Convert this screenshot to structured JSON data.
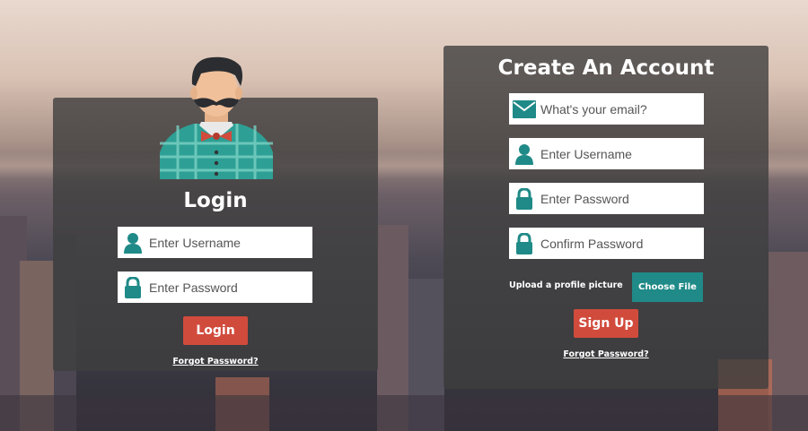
{
  "colors": {
    "accent_teal": "#1f8a87",
    "button_red": "#d14b3c",
    "panel_bg": "#3e3e3e"
  },
  "login": {
    "avatar_icon": "hipster-avatar-icon",
    "title": "Login",
    "username_placeholder": "Enter Username",
    "password_placeholder": "Enter Password",
    "submit_label": "Login",
    "forgot_label": "Forgot Password?"
  },
  "signup": {
    "title": "Create An Account",
    "email_placeholder": "What's your email?",
    "username_placeholder": "Enter Username",
    "password_placeholder": "Enter Password",
    "confirm_placeholder": "Confirm Password",
    "upload_label": "Upload a profile picture",
    "choose_file_label": "Choose File",
    "submit_label": "Sign Up",
    "forgot_label": "Forgot Password?"
  }
}
